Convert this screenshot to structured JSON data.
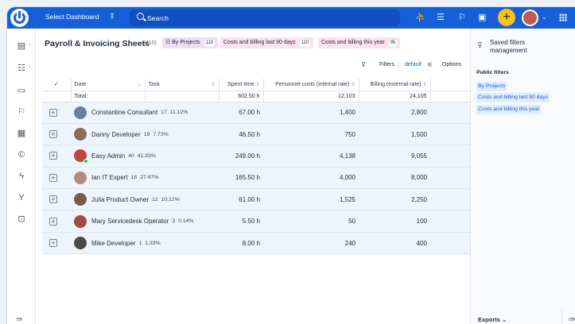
{
  "topbar": {
    "dashboard_select": "Select Dashboard",
    "search_label": "Search",
    "icons": [
      "user-icon",
      "checklist-icon",
      "flag-icon",
      "calendar-icon"
    ],
    "add_label": "+",
    "brand_color": "#1560d9",
    "add_color": "#f9c11a"
  },
  "sidebar": {
    "icons": [
      "dashboard-icon",
      "list-icon",
      "card-icon",
      "flag-icon",
      "table-icon",
      "currency-icon",
      "zap-icon",
      "branch-icon",
      "box-icon",
      "collapse-icon"
    ]
  },
  "page": {
    "title": "Payroll & Invoicing Sheets",
    "count": "(110)",
    "chips": [
      {
        "label": "By Projects",
        "count": "110"
      },
      {
        "label": "Costs and billing last 90 days",
        "count": "110"
      },
      {
        "label": "Costs and billing this year",
        "count": "95"
      }
    ],
    "filters_label": "Filters",
    "default_label": "default",
    "options_label": "Options"
  },
  "table": {
    "headers": {
      "check": "✓",
      "date": "Date",
      "task": "Task",
      "spent": "Spent time",
      "personnel": "Personnel costs (internal rate)",
      "billing": "Billing (external rate)"
    },
    "total": {
      "label": "Total:",
      "spent": "602.50 h",
      "personnel": "12,103",
      "billing": "24,105"
    },
    "rows": [
      {
        "name": "Constantine Consultant",
        "num": "17",
        "pct": "11.12%",
        "spent": "67.00 h",
        "personnel": "1,400",
        "billing": "2,800",
        "avatar_color": "#6b7fa3",
        "online": false
      },
      {
        "name": "Danny Developer",
        "num": "19",
        "pct": "7.72%",
        "spent": "46.50 h",
        "personnel": "750",
        "billing": "1,500",
        "avatar_color": "#8a6f5c",
        "online": false
      },
      {
        "name": "Easy Admin",
        "num": "40",
        "pct": "41.33%",
        "spent": "249.00 h",
        "personnel": "4,138",
        "billing": "9,055",
        "avatar_color": "#c0453b",
        "online": true
      },
      {
        "name": "Ian IT Expert",
        "num": "18",
        "pct": "27.47%",
        "spent": "165.50 h",
        "personnel": "4,000",
        "billing": "8,000",
        "avatar_color": "#b58a7a",
        "online": false
      },
      {
        "name": "Julia Product Owner",
        "num": "12",
        "pct": "10.12%",
        "spent": "61.00 h",
        "personnel": "1,525",
        "billing": "2,250",
        "avatar_color": "#7a5a4e",
        "online": false
      },
      {
        "name": "Mary Servicedesk Operator",
        "num": "3",
        "pct": "0.14%",
        "spent": "5.50 h",
        "personnel": "50",
        "billing": "100",
        "avatar_color": "#a04a44",
        "online": false
      },
      {
        "name": "Mike Developer",
        "num": "1",
        "pct": "1.33%",
        "spent": "8.00 h",
        "personnel": "240",
        "billing": "400",
        "avatar_color": "#4a4a4a",
        "online": false
      }
    ]
  },
  "right_panel": {
    "title": "Saved filters management",
    "public_filters": "Public filters",
    "links": [
      "By Projects",
      "Costs and billing last 90 days",
      "Costs and billing this year"
    ],
    "exports": "Exports"
  }
}
